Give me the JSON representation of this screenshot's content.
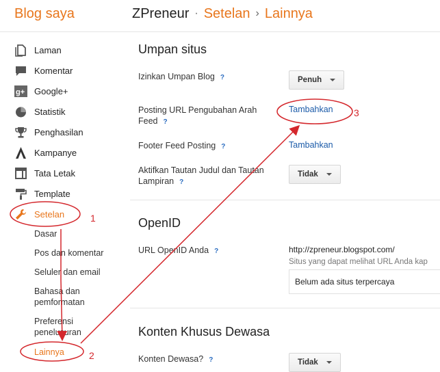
{
  "header": {
    "brand": "Blog saya",
    "breadcrumb": [
      "ZPreneur",
      "·",
      "Setelan",
      "›",
      "Lainnya"
    ]
  },
  "sidebar": {
    "items": [
      {
        "label": "Laman",
        "icon": "page-icon"
      },
      {
        "label": "Komentar",
        "icon": "comment-icon"
      },
      {
        "label": "Google+",
        "icon": "google-plus-icon"
      },
      {
        "label": "Statistik",
        "icon": "pie-chart-icon"
      },
      {
        "label": "Penghasilan",
        "icon": "trophy-icon"
      },
      {
        "label": "Kampanye",
        "icon": "adwords-icon"
      },
      {
        "label": "Tata Letak",
        "icon": "layout-icon"
      },
      {
        "label": "Template",
        "icon": "paint-roller-icon"
      },
      {
        "label": "Setelan",
        "icon": "wrench-icon",
        "active": true
      }
    ],
    "subitems": [
      "Dasar",
      "Pos dan komentar",
      "Seluler dan email",
      "Bahasa dan\npemformatan",
      "Preferensi\npenelusuran",
      "Lainnya"
    ]
  },
  "main": {
    "site_feed": {
      "title": "Umpan situs",
      "allow_feed_label": "Izinkan Umpan Blog",
      "allow_feed_value": "Penuh",
      "post_redirect_label": "Posting URL Pengubahan Arah Feed",
      "post_redirect_link": "Tambahkan",
      "footer_label": "Footer Feed Posting",
      "footer_link": "Tambahkan",
      "title_links_label": "Aktifkan Tautan Judul dan Tautan Lampiran",
      "title_links_value": "Tidak"
    },
    "openid": {
      "title": "OpenID",
      "url_label": "URL OpenID Anda",
      "url_value": "http://zpreneur.blogspot.com/",
      "trusted_hint": "Situs yang dapat melihat URL Anda kap",
      "trusted_empty": "Belum ada situs terpercaya"
    },
    "adult": {
      "title": "Konten Khusus Dewasa",
      "adult_label": "Konten Dewasa?",
      "adult_value": "Tidak"
    },
    "help_glyph": "?"
  },
  "annotations": {
    "numbers": [
      "1",
      "2",
      "3"
    ],
    "color": "#d4272c"
  }
}
